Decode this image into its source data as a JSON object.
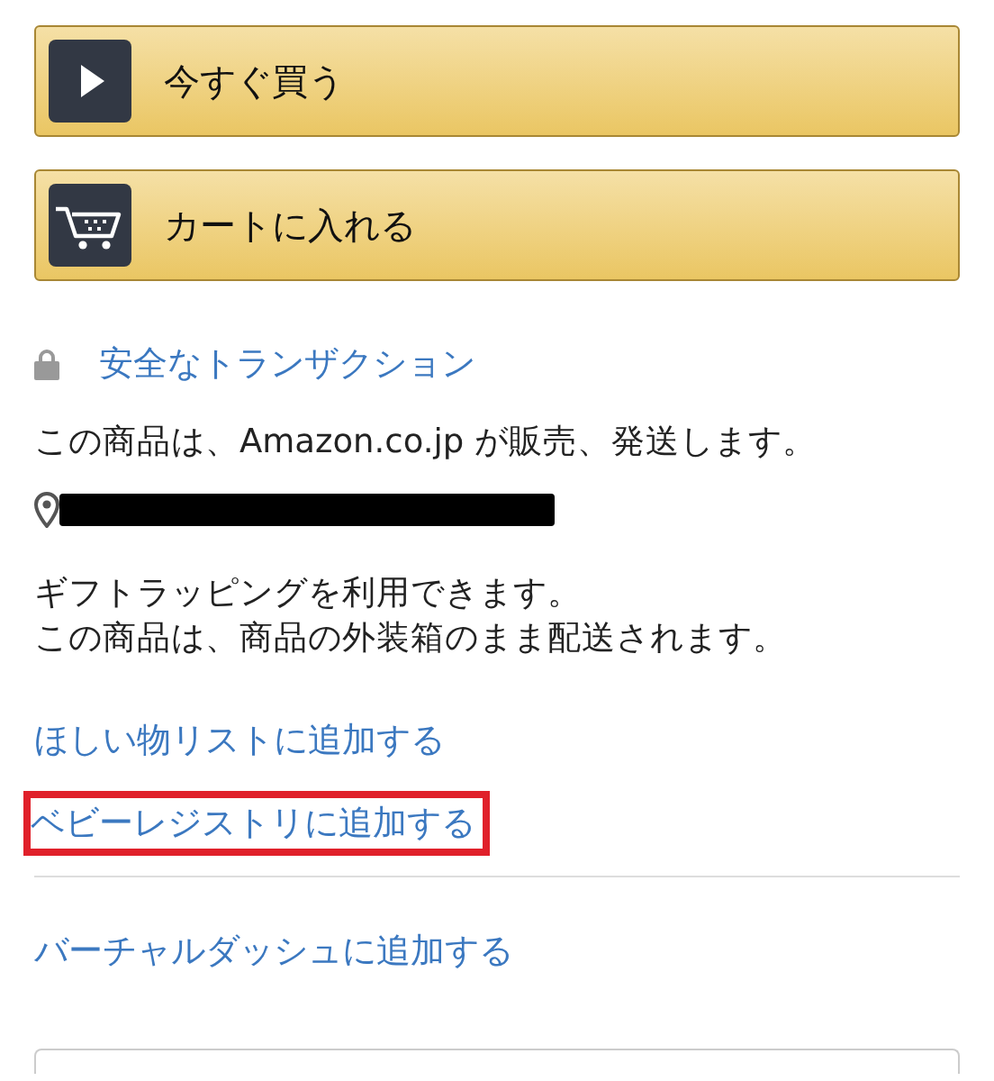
{
  "buttons": [
    {
      "label": "今すぐ買う",
      "kind": "buy"
    },
    {
      "label": "カートに入れる",
      "kind": "cart"
    }
  ],
  "secure_link": "安全なトランザクション",
  "seller_text": "この商品は、Amazon.co.jp が販売、発送します。",
  "delivery_location": {
    "redacted": true
  },
  "notes": [
    "ギフトラッピングを利用できます。",
    "この商品は、商品の外装箱のまま配送されます。"
  ],
  "list_links": [
    {
      "label": "ほしい物リストに追加する",
      "highlighted": false
    },
    {
      "label": "ベビーレジストリに追加する",
      "highlighted": true
    }
  ],
  "bottom_link": "バーチャルダッシュに追加する"
}
